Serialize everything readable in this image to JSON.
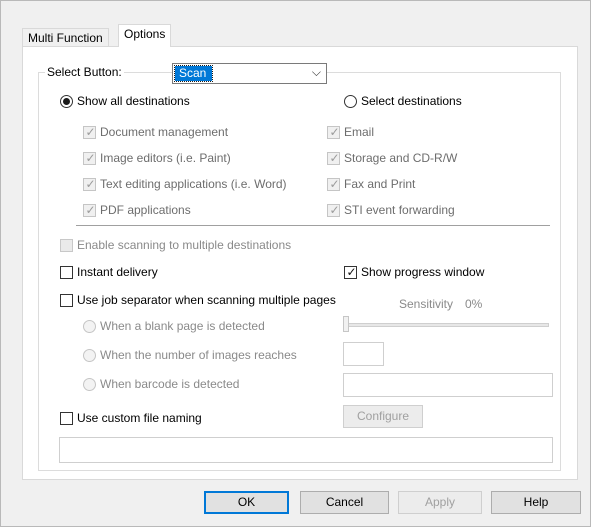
{
  "tabs": [
    {
      "label": "Multi Function",
      "active": false
    },
    {
      "label": "Options",
      "active": true
    }
  ],
  "select_button": {
    "label": "Select Button:",
    "value": "Scan"
  },
  "show_mode": {
    "show_all": {
      "label": "Show all destinations",
      "selected": true
    },
    "select_dest": {
      "label": "Select destinations",
      "selected": false
    }
  },
  "destinations": {
    "left": [
      {
        "label": "Document management",
        "checked": true
      },
      {
        "label": "Image editors (i.e. Paint)",
        "checked": true
      },
      {
        "label": "Text editing applications (i.e. Word)",
        "checked": true
      },
      {
        "label": "PDF applications",
        "checked": true
      }
    ],
    "right": [
      {
        "label": "Email",
        "checked": true
      },
      {
        "label": "Storage and CD-R/W",
        "checked": true
      },
      {
        "label": "Fax and Print",
        "checked": true
      },
      {
        "label": "STI event forwarding",
        "checked": true
      }
    ]
  },
  "options": {
    "multi_dest": {
      "label": "Enable scanning to multiple destinations",
      "checked": false,
      "disabled": true
    },
    "instant_delivery": {
      "label": "Instant delivery",
      "checked": false
    },
    "show_progress": {
      "label": "Show progress window",
      "checked": true
    },
    "job_separator": {
      "label": "Use job separator when scanning multiple pages",
      "checked": false
    },
    "sensitivity_label": "Sensitivity",
    "sensitivity_value": "0%",
    "blank_page": {
      "label": "When a blank page is detected"
    },
    "num_images": {
      "label": "When the number of images reaches"
    },
    "barcode": {
      "label": "When barcode is detected"
    },
    "custom_naming": {
      "label": "Use custom file naming",
      "checked": false
    },
    "configure_label": "Configure"
  },
  "buttons": {
    "ok": "OK",
    "cancel": "Cancel",
    "apply": "Apply",
    "help": "Help"
  }
}
